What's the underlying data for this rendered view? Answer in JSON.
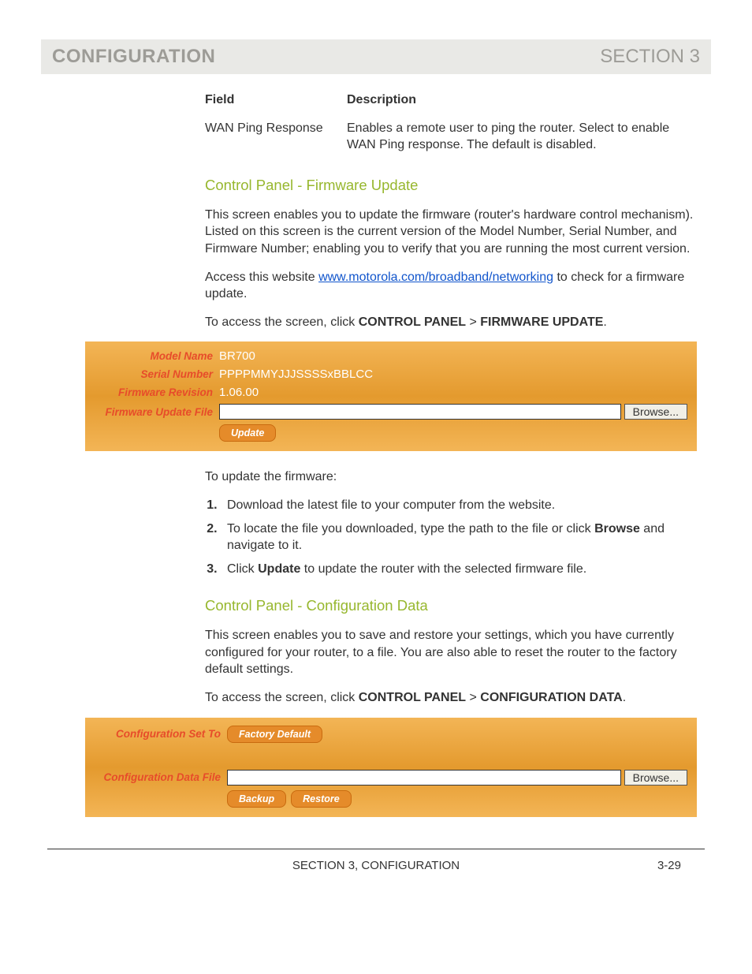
{
  "header": {
    "title_left": "CONFIGURATION",
    "title_right": "SECTION 3"
  },
  "field_table": {
    "head_field": "Field",
    "head_desc": "Description",
    "rows": [
      {
        "field": "WAN Ping Response",
        "desc": "Enables a remote user to ping the router. Select to enable WAN Ping response. The default is disabled."
      }
    ]
  },
  "firmware_section": {
    "heading": "Control Panel - Firmware Update",
    "para1": "This screen enables you to update the firmware (router's hardware control mechanism). Listed on this screen is the current version of the Model Number, Serial Number, and Firmware Number; enabling you to verify that you are running the most current version.",
    "para2_pre": "Access this website ",
    "para2_link": "www.motorola.com/broadband/networking",
    "para2_post": " to check for a firmware update.",
    "para3_pre": "To access the screen, click ",
    "para3_b1": "CONTROL PANEL",
    "para3_gt": " > ",
    "para3_b2": "FIRMWARE UPDATE",
    "para3_post": "."
  },
  "firmware_panel": {
    "model_label": "Model Name",
    "model_value": "BR700",
    "serial_label": "Serial Number",
    "serial_value": "PPPPMMYJJJSSSSxBBLCC",
    "rev_label": "Firmware Revision",
    "rev_value": "1.06.00",
    "file_label": "Firmware Update File",
    "browse_label": "Browse...",
    "update_label": "Update"
  },
  "firmware_steps": {
    "intro": "To update the firmware:",
    "s1": "Download the latest file to your computer from the website.",
    "s2_pre": "To locate the file you downloaded, type the path to the file or click ",
    "s2_b": "Browse",
    "s2_post": " and navigate to it.",
    "s3_pre": "Click ",
    "s3_b": "Update",
    "s3_post": " to update the router with the selected firmware file."
  },
  "config_section": {
    "heading": "Control Panel - Configuration Data",
    "para1": "This screen enables you to save and restore your settings, which you have currently configured for your router, to a file. You are also able to reset the router to the factory default settings.",
    "para2_pre": "To access the screen, click ",
    "para2_b1": "CONTROL PANEL",
    "para2_gt": " > ",
    "para2_b2": "CONFIGURATION DATA",
    "para2_post": "."
  },
  "config_panel": {
    "set_label": "Configuration Set To",
    "factory_label": "Factory Default",
    "file_label": "Configuration Data File",
    "browse_label": "Browse...",
    "backup_label": "Backup",
    "restore_label": "Restore"
  },
  "footer": {
    "center": "SECTION 3, CONFIGURATION",
    "pagenum": "3-29"
  }
}
